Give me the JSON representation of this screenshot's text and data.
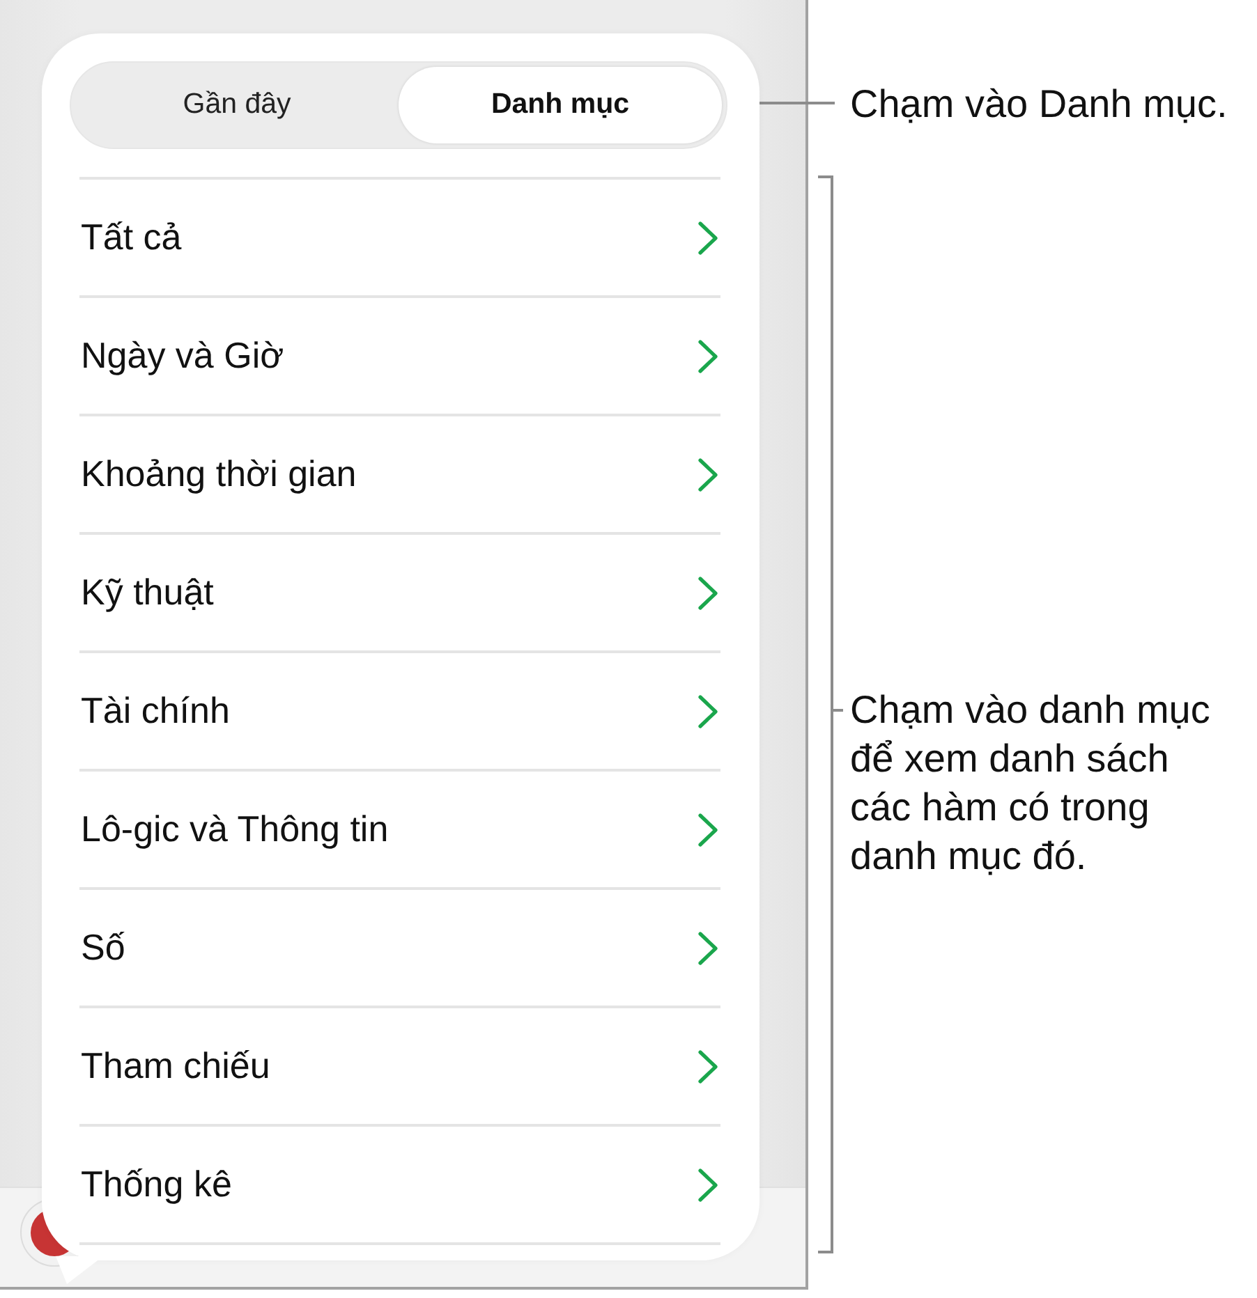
{
  "segmented_control": {
    "tabs": [
      {
        "label": "Gần đây",
        "selected": false
      },
      {
        "label": "Danh mục",
        "selected": true
      }
    ]
  },
  "categories": [
    {
      "label": "Tất cả"
    },
    {
      "label": "Ngày và Giờ"
    },
    {
      "label": "Khoảng thời gian"
    },
    {
      "label": "Kỹ thuật"
    },
    {
      "label": "Tài chính"
    },
    {
      "label": "Lô-gic và Thông tin"
    },
    {
      "label": "Số"
    },
    {
      "label": "Tham chiếu"
    },
    {
      "label": "Thống kê"
    }
  ],
  "callouts": [
    {
      "text": "Chạm vào Danh mục."
    },
    {
      "text": "Chạm vào danh mục để xem danh sách các hàm có trong danh mục đó."
    }
  ]
}
